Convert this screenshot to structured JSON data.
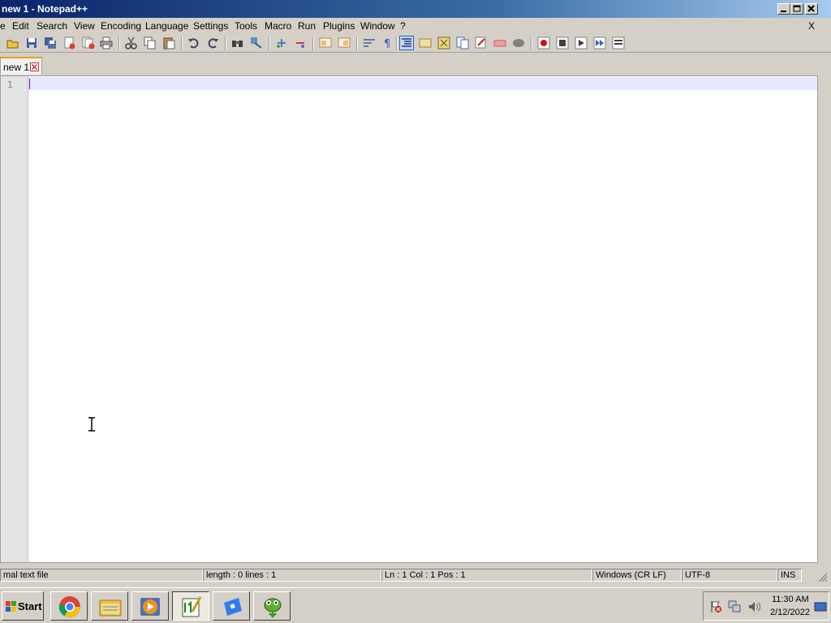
{
  "window": {
    "title": "new 1 - Notepad++"
  },
  "menu": {
    "items": [
      "e",
      "Edit",
      "Search",
      "View",
      "Encoding",
      "Language",
      "Settings",
      "Tools",
      "Macro",
      "Run",
      "Plugins",
      "Window",
      "?"
    ],
    "close_label": "X"
  },
  "toolbar": {
    "icons": [
      "open-icon",
      "save-icon",
      "save-all-icon",
      "close-icon",
      "close-all-icon",
      "print-icon",
      "cut-icon",
      "copy-icon",
      "paste-icon",
      "undo-icon",
      "redo-icon",
      "find-icon",
      "replace-icon",
      "zoom-in-icon",
      "zoom-out-icon",
      "sync-v-icon",
      "sync-h-icon",
      "word-wrap-icon",
      "show-all-chars-icon",
      "indent-guide-icon",
      "lang-icon",
      "doc-map-icon",
      "func-list-icon",
      "folder-workspace-icon",
      "monitor-icon",
      "record-macro-icon",
      "stop-macro-icon",
      "play-macro-icon",
      "run-macro-multiple-icon",
      "save-macro-icon"
    ]
  },
  "tab": {
    "label": "new 1"
  },
  "editor": {
    "line_numbers": [
      "1"
    ]
  },
  "status": {
    "file_type": "mal text file",
    "length_lines": "length : 0    lines : 1",
    "position": "Ln : 1    Col : 1    Pos : 1",
    "eol": "Windows (CR LF)",
    "encoding": "UTF-8",
    "mode": "INS"
  },
  "taskbar": {
    "start_label": "Start",
    "clock_time": "11:30 AM",
    "clock_date": "2/12/2022",
    "apps": [
      "chrome-icon",
      "file-explorer-icon",
      "media-player-icon",
      "notepadpp-icon",
      "roblox-icon",
      "gecko-icon"
    ]
  }
}
